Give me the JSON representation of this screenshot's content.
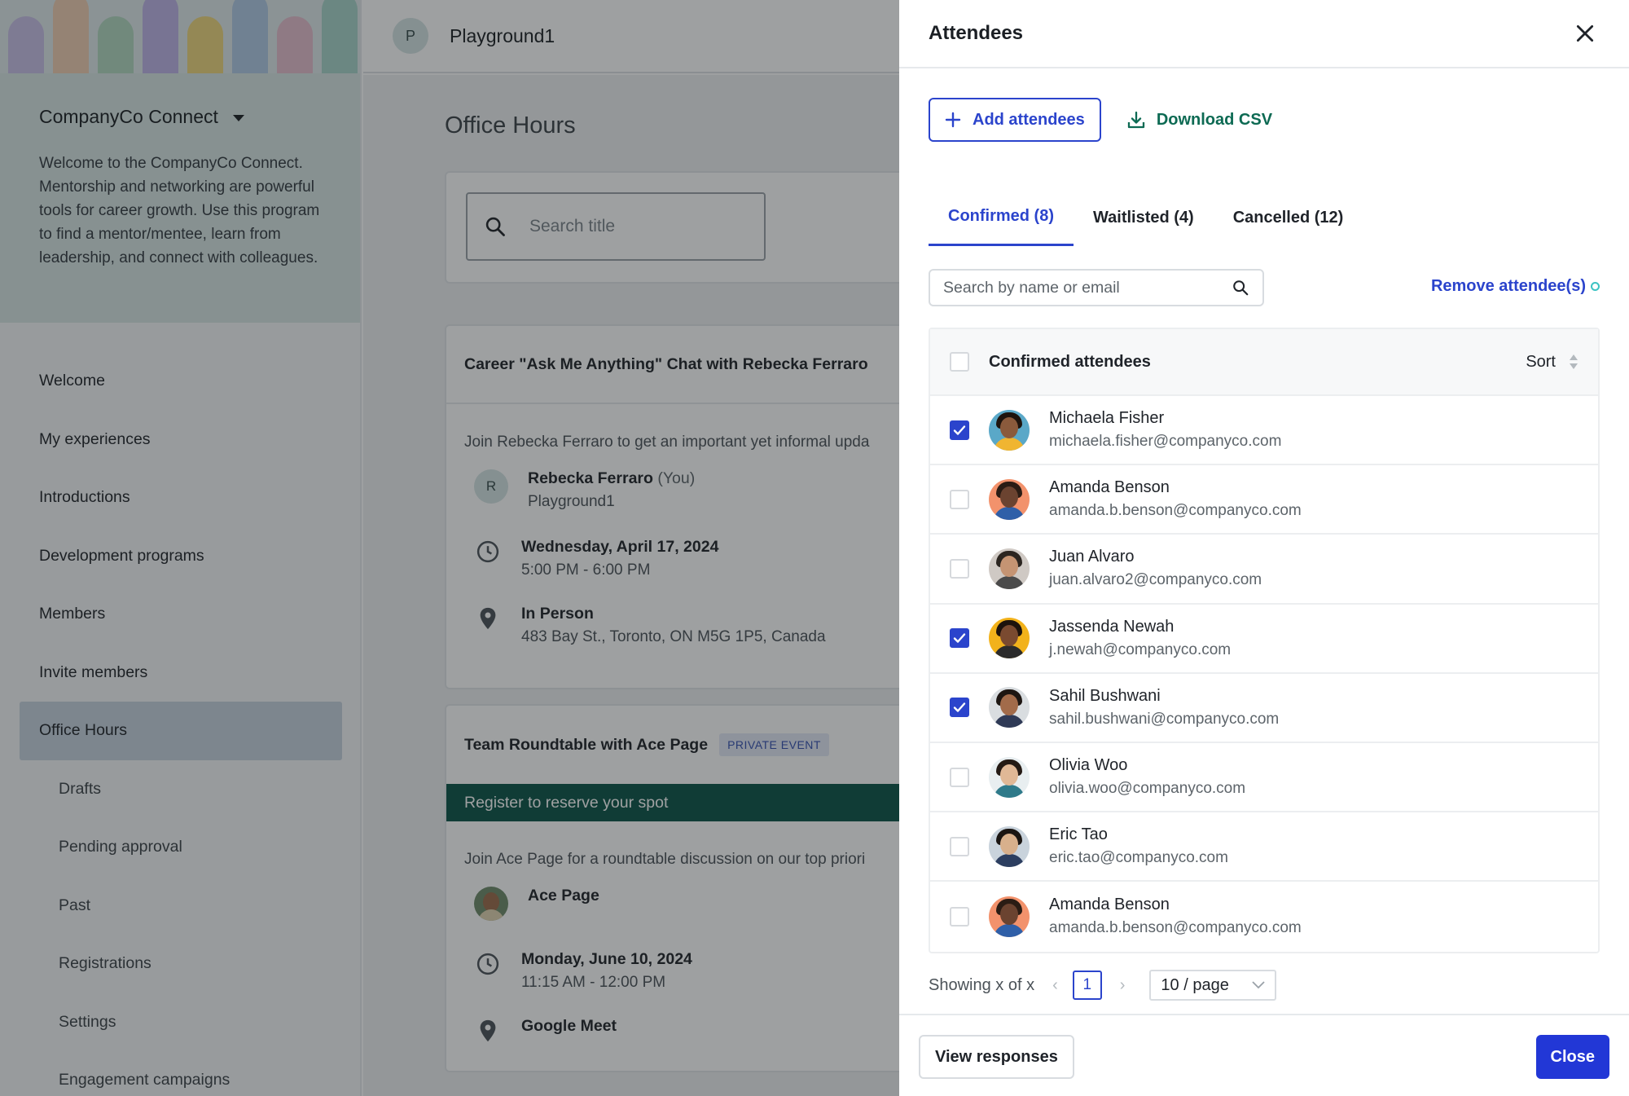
{
  "banner": {
    "colors": [
      "#c6b8e6",
      "#f2c8a8",
      "#a9d3b9",
      "#b7a9e6",
      "#f1d26a",
      "#a8c4e4",
      "#e7b6c9",
      "#9dd0c4"
    ]
  },
  "sidebar": {
    "program_name": "CompanyCo Connect",
    "program_description": "Welcome to the CompanyCo Connect. Mentorship and networking are powerful tools for career growth. Use this program to find a mentor/mentee, learn from leadership, and connect with colleagues.",
    "items": [
      {
        "label": "Welcome"
      },
      {
        "label": "My experiences"
      },
      {
        "label": "Introductions"
      },
      {
        "label": "Development programs"
      },
      {
        "label": "Members"
      },
      {
        "label": "Invite members"
      },
      {
        "label": "Office Hours"
      },
      {
        "label": "Drafts"
      },
      {
        "label": "Pending approval"
      },
      {
        "label": "Past"
      },
      {
        "label": "Registrations"
      },
      {
        "label": "Settings"
      },
      {
        "label": "Engagement campaigns"
      }
    ]
  },
  "topbar": {
    "workspace_initial": "P",
    "workspace_name": "Playground1"
  },
  "main": {
    "page_title": "Office Hours",
    "search_placeholder": "Search title",
    "events": [
      {
        "title": "Career \"Ask Me Anything\" Chat with Rebecka Ferraro",
        "description": "Join Rebecka Ferraro to get an important yet informal upda",
        "host_initial": "R",
        "host_name": "Rebecka Ferraro",
        "host_suffix": "(You)",
        "host_org": "Playground1",
        "date": "Wednesday, April 17, 2024",
        "time": "5:00 PM - 6:00 PM",
        "location_type": "In Person",
        "address": "483 Bay St., Toronto, ON M5G 1P5, Canada"
      },
      {
        "title": "Team Roundtable with Ace Page",
        "badge": "PRIVATE EVENT",
        "register_text": "Register to reserve your spot",
        "description": "Join Ace Page for a roundtable discussion on our top priori",
        "host_name": "Ace Page",
        "date": "Monday, June 10, 2024",
        "time": "11:15 AM - 12:00 PM",
        "location_type": "Google Meet"
      }
    ]
  },
  "drawer": {
    "title": "Attendees",
    "add_label": "Add attendees",
    "csv_label": "Download CSV",
    "tabs": [
      {
        "label": "Confirmed (8)"
      },
      {
        "label": "Waitlisted (4)"
      },
      {
        "label": "Cancelled (12)"
      }
    ],
    "search_placeholder": "Search by name or email",
    "remove_label": "Remove attendee(s)",
    "table_header": "Confirmed attendees",
    "sort_label": "Sort",
    "attendees": [
      {
        "name": "Michaela Fisher",
        "email": "michaela.fisher@companyco.com",
        "checked": true,
        "skin": "#8a5a3c",
        "hair": "#1e140e",
        "shirt": "#f0b531",
        "bg": "#5aa8c8"
      },
      {
        "name": "Amanda Benson",
        "email": "amanda.b.benson@companyco.com",
        "checked": false,
        "skin": "#6b4330",
        "hair": "#2a1c14",
        "shirt": "#2f5fa8",
        "bg": "#f2926c"
      },
      {
        "name": "Juan Alvaro",
        "email": "juan.alvaro2@companyco.com",
        "checked": false,
        "skin": "#c59473",
        "hair": "#2b2520",
        "shirt": "#4a4a4a",
        "bg": "#cfc9c4"
      },
      {
        "name": "Jassenda Newah",
        "email": "j.newah@companyco.com",
        "checked": true,
        "skin": "#7a4a30",
        "hair": "#1c120c",
        "shirt": "#2b2b2b",
        "bg": "#f2b21b"
      },
      {
        "name": "Sahil Bushwani",
        "email": "sahil.bushwani@companyco.com",
        "checked": true,
        "skin": "#a26b4a",
        "hair": "#1d1612",
        "shirt": "#2f3a56",
        "bg": "#d9dde0"
      },
      {
        "name": "Olivia Woo",
        "email": "olivia.woo@companyco.com",
        "checked": false,
        "skin": "#e0b896",
        "hair": "#241a14",
        "shirt": "#2f7a8a",
        "bg": "#e8eef0"
      },
      {
        "name": "Eric Tao",
        "email": "eric.tao@companyco.com",
        "checked": false,
        "skin": "#d8b08c",
        "hair": "#1a1512",
        "shirt": "#2c3e60",
        "bg": "#c9d3dc"
      },
      {
        "name": "Amanda Benson",
        "email": "amanda.b.benson@companyco.com",
        "checked": false,
        "skin": "#6b4330",
        "hair": "#2a1c14",
        "shirt": "#2f5fa8",
        "bg": "#f2926c"
      }
    ],
    "pager": {
      "showing": "Showing x of x",
      "page": "1",
      "page_size": "10 / page"
    },
    "view_responses_label": "View responses",
    "close_label": "Close"
  }
}
